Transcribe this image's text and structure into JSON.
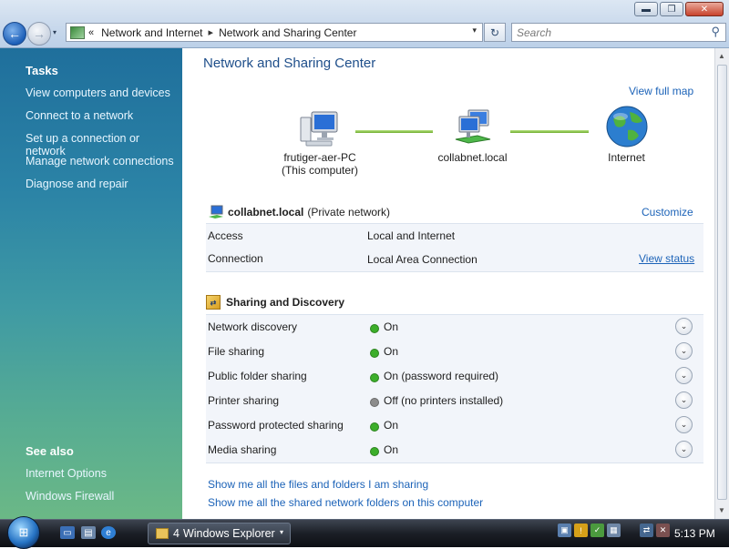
{
  "window": {
    "minimize_glyph": "▬",
    "maximize_glyph": "❐",
    "close_glyph": "✕"
  },
  "toolbar": {
    "back_glyph": "←",
    "forward_glyph": "→",
    "recent_glyph": "▾",
    "breadcrumb": [
      "Network and Internet",
      "Network and Sharing Center"
    ],
    "address_prefix": "«",
    "separator": "▸",
    "refresh_glyph": "↻",
    "search_placeholder": "Search",
    "search_glyph": "⚲"
  },
  "sidebar": {
    "tasks_heading": "Tasks",
    "tasks": [
      "View computers and devices",
      "Connect to a network",
      "Set up a connection or network",
      "Manage network connections",
      "Diagnose and repair"
    ],
    "see_also_heading": "See also",
    "see_also": [
      "Internet Options",
      "Windows Firewall"
    ]
  },
  "main": {
    "title": "Network and Sharing Center",
    "view_full_map": "View full map",
    "map": {
      "computer_name": "frutiger-aer-PC",
      "computer_sub": "(This computer)",
      "network_name": "collabnet.local",
      "internet": "Internet"
    },
    "network": {
      "name": "collabnet.local",
      "type": "(Private network)",
      "customize": "Customize",
      "access_label": "Access",
      "access_value": "Local and Internet",
      "connection_label": "Connection",
      "connection_value": "Local Area Connection",
      "view_status": "View status"
    },
    "sharing": {
      "heading": "Sharing and Discovery",
      "items": [
        {
          "label": "Network discovery",
          "status": "On",
          "state": "on"
        },
        {
          "label": "File sharing",
          "status": "On",
          "state": "on"
        },
        {
          "label": "Public folder sharing",
          "status": "On (password required)",
          "state": "on"
        },
        {
          "label": "Printer sharing",
          "status": "Off (no printers installed)",
          "state": "off"
        },
        {
          "label": "Password protected sharing",
          "status": "On",
          "state": "on"
        },
        {
          "label": "Media sharing",
          "status": "On",
          "state": "on"
        }
      ],
      "expand_glyph": "⌄"
    },
    "bottom_links": [
      "Show me all the files and folders I am sharing",
      "Show me all the shared network folders on this computer"
    ]
  },
  "taskbar": {
    "task_count": "4",
    "task_label": "Windows Explorer",
    "task_caret": "▾",
    "clock": "5:13 PM"
  },
  "colors": {
    "status_on": "#3cae2a",
    "status_off": "#8c8c8c",
    "link": "#1c63b8"
  }
}
